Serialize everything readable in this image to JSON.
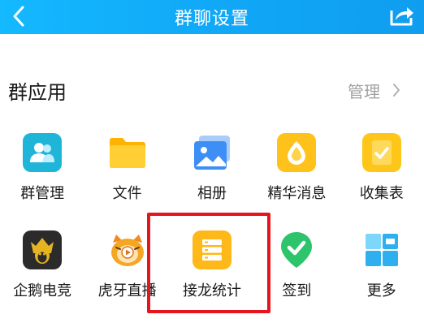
{
  "header": {
    "title": "群聊设置",
    "back_icon": "chevron-left-icon",
    "share_icon": "share-icon",
    "colors": {
      "bar": "#11a8f7"
    }
  },
  "section": {
    "title": "群应用",
    "manage_label": "管理",
    "manage_icon": "chevron-right-icon"
  },
  "apps": [
    {
      "label": "群管理",
      "icon": "group-manage-icon",
      "color": "#1fb5d9"
    },
    {
      "label": "文件",
      "icon": "folder-icon",
      "color": "#ffc61a"
    },
    {
      "label": "相册",
      "icon": "album-icon",
      "color": "#3d8ef5"
    },
    {
      "label": "精华消息",
      "icon": "essence-icon",
      "color": "#ffc21a"
    },
    {
      "label": "收集表",
      "icon": "collect-form-icon",
      "color": "#ffc61a"
    },
    {
      "label": "企鹅电竞",
      "icon": "penguin-esports-icon",
      "color": "#2b2b2b"
    },
    {
      "label": "虎牙直播",
      "icon": "huya-icon",
      "color": "#f5a623"
    },
    {
      "label": "接龙统计",
      "icon": "relay-stats-icon",
      "color": "#ffb81a",
      "highlighted": true
    },
    {
      "label": "签到",
      "icon": "check-in-icon",
      "color": "#2ec46b"
    },
    {
      "label": "更多",
      "icon": "more-grid-icon",
      "color": "#2fb0ee"
    }
  ],
  "highlight_color": "#e5141d"
}
